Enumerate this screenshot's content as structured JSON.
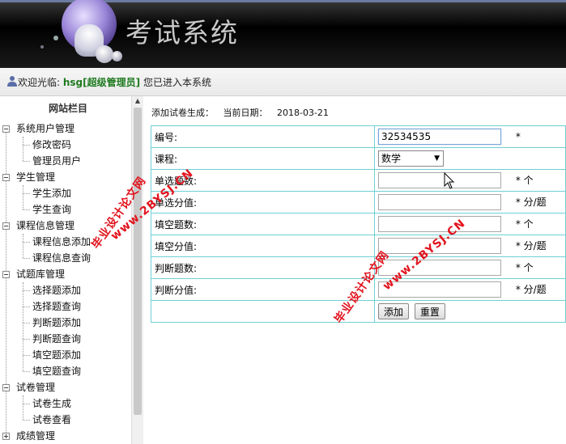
{
  "header": {
    "app_title": "考试系统"
  },
  "welcome": {
    "prefix": "欢迎光临:",
    "username": "hsg[超级管理员]",
    "suffix": "您已进入本系统"
  },
  "sidebar": {
    "title": "网站栏目",
    "groups": [
      {
        "label": "系统用户管理",
        "children": [
          "修改密码",
          "管理员用户"
        ]
      },
      {
        "label": "学生管理",
        "children": [
          "学生添加",
          "学生查询"
        ]
      },
      {
        "label": "课程信息管理",
        "children": [
          "课程信息添加",
          "课程信息查询"
        ]
      },
      {
        "label": "试题库管理",
        "children": [
          "选择题添加",
          "选择题查询",
          "判断题添加",
          "判断题查询",
          "填空题添加",
          "填空题查询"
        ]
      },
      {
        "label": "试卷管理",
        "children": [
          "试卷生成",
          "试卷查看"
        ]
      },
      {
        "label": "成绩管理",
        "children": []
      }
    ]
  },
  "main": {
    "page_label": "添加试卷生成：",
    "date_label": "当前日期：",
    "date_value": "2018-03-21",
    "form": {
      "id_label": "编号:",
      "id_value": "32534535",
      "id_suffix": "*",
      "course_label": "课程:",
      "course_value": "数学",
      "single_count_label": "单选题数:",
      "single_count_suffix": "* 个",
      "single_score_label": "单选分值:",
      "single_score_suffix": "* 分/题",
      "blank_count_label": "填空题数:",
      "blank_count_suffix": "* 个",
      "blank_score_label": "填空分值:",
      "blank_score_suffix": "* 分/题",
      "judge_count_label": "判断题数:",
      "judge_count_suffix": "* 个",
      "judge_score_label": "判断分值:",
      "judge_score_suffix": "* 分/题",
      "add_button": "添加",
      "reset_button": "重置"
    }
  },
  "watermark": {
    "line1": "毕业设计论文网",
    "line2": "www.2BYSJ.CN"
  },
  "colors": {
    "table_border": "#6fd0d6",
    "username": "#1e7a1e",
    "watermark": "#e2141e"
  }
}
